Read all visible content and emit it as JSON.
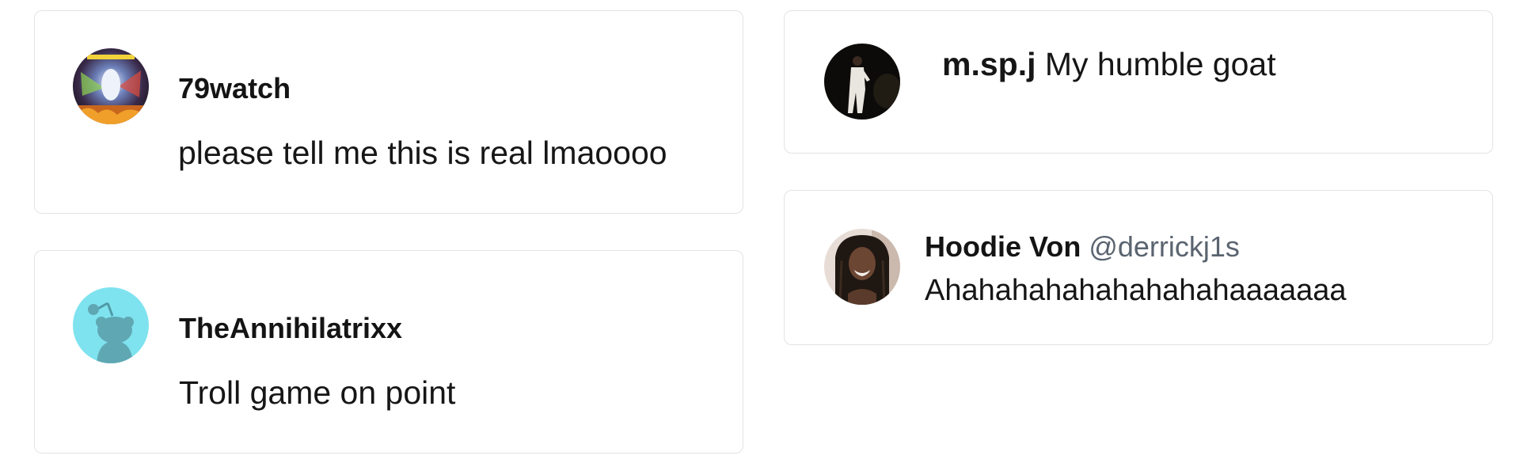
{
  "comments": [
    {
      "username": "79watch",
      "text": "please tell me this is real lmaoooo",
      "avatar": "game-screenshot-avatar"
    },
    {
      "username": "TheAnnihilatrixx",
      "text": "Troll game on point",
      "avatar": "reddit-snoo-avatar"
    },
    {
      "username": "m.sp.j",
      "text": "My humble goat",
      "avatar": "person-in-white-suit-avatar"
    },
    {
      "username": "Hoodie Von",
      "handle": "@derrickj1s",
      "text": "Ahahahahahahahahahaaaaaaa",
      "avatar": "person-with-locs-avatar"
    }
  ],
  "colors": {
    "card_border": "#e3e3e3",
    "handle": "#5a6470",
    "reddit_avatar_bg": "#7fe3ef"
  }
}
